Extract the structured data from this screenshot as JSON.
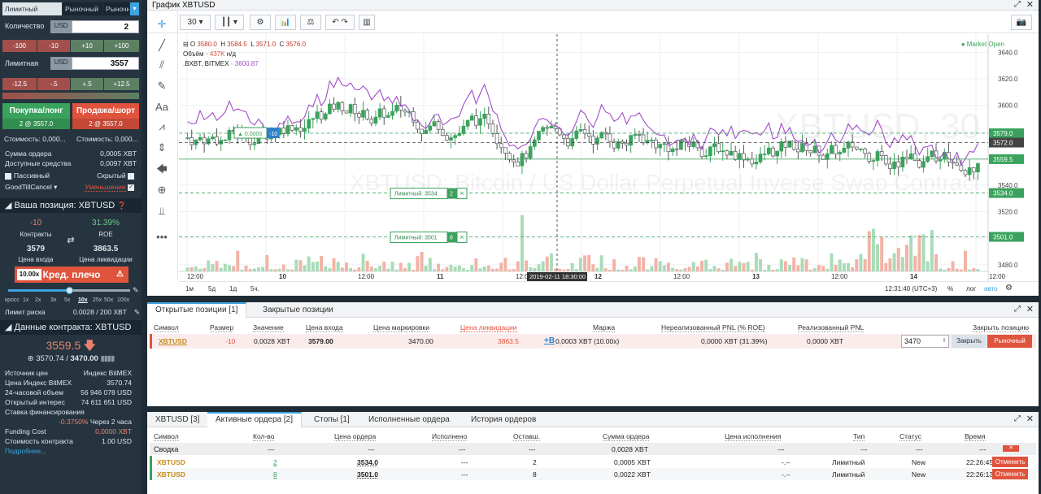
{
  "sidebar": {
    "order_tabs": [
      "Лимитный",
      "Рыночный",
      "Рыночный стоп"
    ],
    "quantity": {
      "label": "Количество",
      "currency": "USD",
      "value": "2"
    },
    "qty_adjust": [
      "-100",
      "-10",
      "+10",
      "+100"
    ],
    "limit": {
      "label": "Лимитная",
      "currency": "USD",
      "value": "3557"
    },
    "price_adjust": [
      "-12.5",
      "-.5",
      "+.5",
      "+12.5"
    ],
    "buy": {
      "label": "Покупка/лонг",
      "sub": "2 @ 3557.0"
    },
    "sell": {
      "label": "Продажа/шорт",
      "sub": "2 @ 3557.0"
    },
    "cost_buy": "Стоимость: 0,000...",
    "cost_sell": "Стоимость: 0,000...",
    "order_sum": {
      "label": "Сумма ордера",
      "value": "0,0005 XBT"
    },
    "available": {
      "label": "Доступные средства",
      "value": "0,0097 XBT"
    },
    "passive": "Пассивный",
    "hidden": "Скрытый",
    "tif": "GoodTillCancel",
    "reduce": "Уменьшение",
    "position_title": "Ваша позиция: XBTUSD",
    "position": {
      "contracts": "-10",
      "contracts_label": "Контракты",
      "roe": "31.39%",
      "roe_label": "ROE",
      "entry": "3579",
      "entry_label": "Цена входа",
      "liq": "3863.5",
      "liq_label": "Цена ликвидации"
    },
    "leverage": {
      "value": "10.00x",
      "label": "Кред. плечо",
      "fraction": 0.5
    },
    "lev_ticks": [
      "кросс",
      "1x",
      "2x",
      "3x",
      "5x",
      "10x",
      "25x",
      "50x",
      "100x"
    ],
    "risk_limit": {
      "label": "Лимит риска",
      "value": "0.0028 / 200 XBT"
    },
    "contract_title": "Данные контракта: XBTUSD",
    "last_price": "3559.5",
    "mark_index": "3570.74",
    "mark_fair": "3470.00",
    "contract_rows": [
      {
        "label": "Источник цен",
        "value": "Индекс BitMEX"
      },
      {
        "label": "Цена Индекс BitMEX",
        "value": "3570.74"
      },
      {
        "label": "24-часовой объем",
        "value": "56 946 078 USD"
      },
      {
        "label": "Открытый интерес",
        "value": "74 611 651 USD"
      },
      {
        "label": "Ставка финансирования",
        "value": ""
      }
    ],
    "funding_rate": "-0.3750%",
    "funding_in": "Через 2 часа",
    "funding_cost": {
      "label": "Funding Cost",
      "value": "0,0000 XBT"
    },
    "contract_value": {
      "label": "Стоимость контракта",
      "value": "1.00 USD"
    },
    "more": "Подробнее..."
  },
  "chart": {
    "title": "График XBTUSD",
    "interval": "30",
    "ohlc": {
      "o": "3580.0",
      "h": "3584.5",
      "l": "3571.0",
      "c": "3576.0"
    },
    "volume_label": "Объём",
    "volume_value": "437K",
    "volume_na": "н/д",
    "index_label": ".BXBT, BITMEX",
    "index_value": "3600.87",
    "market_status": "Market Open",
    "watermark_sym": "XBTUSD, 30",
    "watermark_desc": "XBTUSD: Bitcoin / US Dollar Perpetual Inverse Swap Contract",
    "price_ticks": [
      "3640.0",
      "3620.0",
      "3600.0",
      "3560.0",
      "3540.0",
      "3520.0",
      "3500.0",
      "3480.0"
    ],
    "price_tags": [
      {
        "v": "3579.0",
        "c": "#3aa25c"
      },
      {
        "v": "3572.0",
        "c": "#444444"
      },
      {
        "v": "3559.5",
        "c": "#3aa25c"
      },
      {
        "v": "3534.0",
        "c": "#3aa25c"
      },
      {
        "v": "3501.0",
        "c": "#3aa25c"
      }
    ],
    "time_ticks": [
      "12:00",
      "10",
      "12:00",
      "11",
      "12:00",
      "12",
      "12:00",
      "13",
      "12:00",
      "14",
      "12:00"
    ],
    "crosshair_time": "2019-02-11 18:30:00",
    "position_line": "-10",
    "order_lines": [
      {
        "label": "Лимитный: 3534",
        "qty": "2"
      },
      {
        "label": "Лимитный: 3501",
        "qty": "8"
      }
    ],
    "range_buttons": [
      "1м",
      "5д",
      "1д",
      "5ч."
    ],
    "clock": "12:31:40 (UTC+3)",
    "scale_opts": [
      "%",
      "лог",
      "авто"
    ]
  },
  "positions": {
    "tabs": [
      "Открытые позиции [1]",
      "Закрытые позиции"
    ],
    "headers": [
      "Символ",
      "Размер",
      "Значение",
      "Цена входа",
      "Цена маркировки",
      "Цена ликвидации",
      "Маржа",
      "Нереализованный PNL (% ROE)",
      "Реализованный PNL",
      "Закрыть позицию"
    ],
    "row": {
      "symbol": "XBTUSD",
      "size": "-10",
      "value": "0,0028 XBT",
      "entry": "3579.00",
      "mark": "3470.00",
      "liq": "3863.5",
      "margin_add": "+B",
      "margin": "0,0003 XBT (10.00x)",
      "upnl": "0,0000 XBT (31.39%)",
      "rpnl": "0,0000 XBT",
      "close_price": "3470",
      "close_btn": "Закрыть",
      "market_btn": "Рыночный"
    }
  },
  "orders": {
    "tabs": [
      "XBTUSD [3]",
      "Активные ордера [2]",
      "Стопы [1]",
      "Исполненные ордера",
      "История ордеров"
    ],
    "headers": [
      "Символ",
      "Кол-во",
      "Цена ордера",
      "Исполнено",
      "Оставш.",
      "Сумма ордера",
      "Цена исполнения",
      "Тип",
      "Статус",
      "Время"
    ],
    "summary": {
      "label": "Сводка",
      "qty": "---",
      "price": "---",
      "filled": "---",
      "remaining": "---",
      "value": "0,0028 XBT",
      "fill_price": "---",
      "type": "---",
      "status": "---",
      "time": "---"
    },
    "rows": [
      {
        "symbol": "XBTUSD",
        "qty": "2",
        "price": "3534.0",
        "filled": "---",
        "remaining": "2",
        "value": "0,0005 XBT",
        "fill_price": "-.--",
        "type": "Лимитный",
        "status": "New",
        "time": "22:26:45",
        "cancel": "Отменить"
      },
      {
        "symbol": "XBTUSD",
        "qty": "8",
        "price": "3501.0",
        "filled": "---",
        "remaining": "8",
        "value": "0,0022 XBT",
        "fill_price": "-.--",
        "type": "Лимитный",
        "status": "New",
        "time": "22:26:13",
        "cancel": "Отменить"
      }
    ]
  },
  "colors": {
    "buy": "#3aa25c",
    "sell": "#e0533d",
    "accent": "#3ea3df",
    "index_line": "#a14dc8"
  }
}
